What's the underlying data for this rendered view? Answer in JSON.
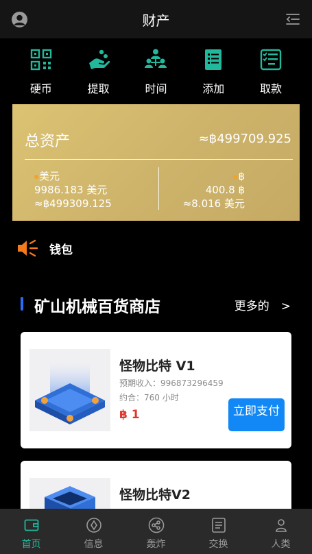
{
  "header": {
    "title": "财产",
    "left_icon": "user-avatar-icon",
    "right_icon": "menu-collapse-icon"
  },
  "quick_actions": [
    {
      "label": "硬币",
      "icon": "qr-grid-icon"
    },
    {
      "label": "提取",
      "icon": "hand-coins-icon"
    },
    {
      "label": "时间",
      "icon": "team-icon"
    },
    {
      "label": "添加",
      "icon": "list-document-icon"
    },
    {
      "label": "取款",
      "icon": "checklist-icon"
    }
  ],
  "assets": {
    "label": "总资产",
    "total": "≈฿499709.925",
    "left": {
      "currency": "美元",
      "amount": "9986.183 美元",
      "converted": "≈฿499309.125"
    },
    "right": {
      "currency": "฿",
      "amount": "400.8 ฿",
      "converted": "≈8.016 美元"
    }
  },
  "wallet": {
    "label": "钱包",
    "icon": "speaker-icon"
  },
  "section": {
    "title": "矿山机械百货商店",
    "more": "更多的　>"
  },
  "products": [
    {
      "name": "怪物比特 V1",
      "meta1": "预期收入：996873296459",
      "meta2": "约合：760 小时",
      "price": "฿ 1",
      "pay_label": "立即支付"
    },
    {
      "name": "怪物比特V2"
    }
  ],
  "tabbar": [
    {
      "label": "首页",
      "icon": "wallet-icon",
      "active": true
    },
    {
      "label": "信息",
      "icon": "compass-icon",
      "active": false
    },
    {
      "label": "轰炸",
      "icon": "share-icon",
      "active": false
    },
    {
      "label": "交换",
      "icon": "document-icon",
      "active": false
    },
    {
      "label": "人类",
      "icon": "person-icon",
      "active": false
    }
  ],
  "colors": {
    "accent": "#21b89c",
    "gold": "#d6bd6e",
    "primary_button": "#1188f5",
    "price": "#e0352b",
    "section_bar": "#2a6cf6"
  }
}
